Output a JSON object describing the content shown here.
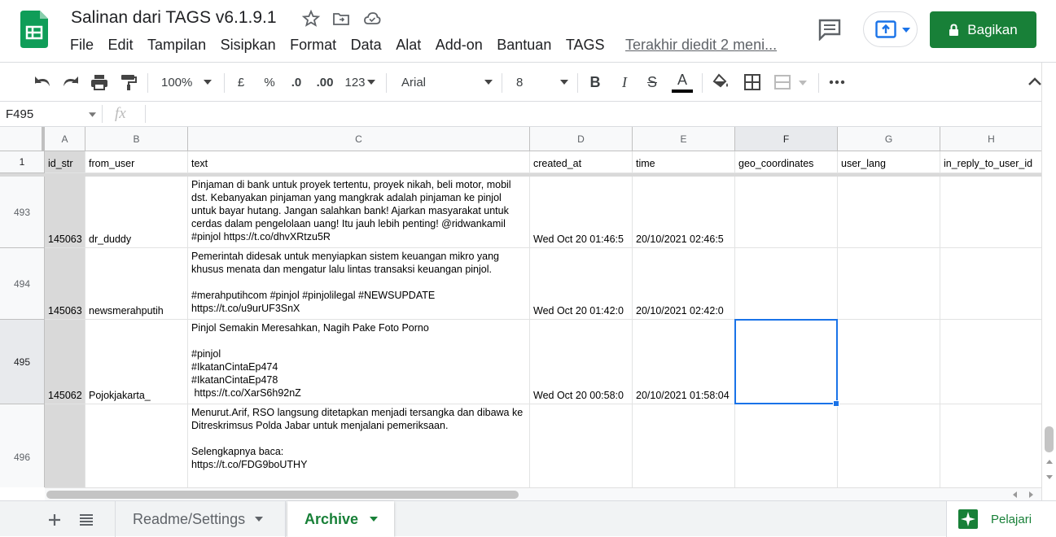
{
  "header": {
    "doc_title": "Salinan dari TAGS v6.1.9.1",
    "menu": [
      "File",
      "Edit",
      "Tampilan",
      "Sisipkan",
      "Format",
      "Data",
      "Alat",
      "Add-on",
      "Bantuan",
      "TAGS"
    ],
    "last_edit": "Terakhir diedit 2 meni...",
    "share_label": "Bagikan",
    "accent": "#188038"
  },
  "toolbar": {
    "zoom": "100%",
    "currency": "£",
    "percent": "%",
    "dec_less": ".0",
    "dec_more": ".00",
    "more_formats": "123",
    "font": "Arial",
    "font_size": "8",
    "bold": "B",
    "italic": "I",
    "strike": "S",
    "text_color": "A"
  },
  "formula_bar": {
    "cell_ref": "F495",
    "fx": "fx",
    "value": ""
  },
  "grid": {
    "columns": [
      "A",
      "B",
      "C",
      "D",
      "E",
      "F",
      "G",
      "H"
    ],
    "header_row_number": "1",
    "header_values": [
      "id_str",
      "from_user",
      "text",
      "created_at",
      "time",
      "geo_coordinates",
      "user_lang",
      "in_reply_to_user_id"
    ],
    "rows": [
      {
        "num": "493",
        "a": "145063",
        "b": "dr_duddy",
        "c": "Pinjaman di bank untuk proyek tertentu, proyek nikah, beli motor, mobil dst. Kebanyakan pinjaman yang mangkrak adalah pinjaman ke pinjol untuk bayar hutang. Jangan salahkan bank! Ajarkan masyarakat untuk cerdas dalam pengelolaan uang! Itu jauh lebih penting! @ridwankamil #pinjol https://t.co/dhvXRtzu5R",
        "d": "Wed Oct 20 01:46:5",
        "e": "20/10/2021 02:46:5"
      },
      {
        "num": "494",
        "a": "145063",
        "b": "newsmerahputih",
        "c": "Pemerintah didesak untuk menyiapkan sistem keuangan mikro yang khusus menata dan mengatur lalu lintas transaksi keuangan pinjol.\n\n#merahputihcom #pinjol #pinjolilegal #NEWSUPDATE\nhttps://t.co/u9urUF3SnX",
        "d": "Wed Oct 20 01:42:0",
        "e": "20/10/2021 02:42:0"
      },
      {
        "num": "495",
        "a": "145062",
        "b": "Pojokjakarta_",
        "c": "Pinjol Semakin Meresahkan, Nagih Pake Foto Porno\n\n#pinjol\n#IkatanCintaEp474\n#IkatanCintaEp478\n https://t.co/XarS6h92nZ",
        "d": "Wed Oct 20 00:58:0",
        "e": "20/10/2021 01:58:04"
      },
      {
        "num": "496",
        "a": "",
        "b": "",
        "c": "Menurut.Arif, RSO langsung ditetapkan menjadi tersangka dan dibawa ke Ditreskrimsus Polda Jabar untuk menjalani pemeriksaan.\n\nSelengkapnya baca:\nhttps://t.co/FDG9boUTHY",
        "d": "",
        "e": ""
      }
    ]
  },
  "sheets": {
    "tabs": [
      "Readme/Settings",
      "Archive"
    ],
    "active": "Archive",
    "explore_label": "Pelajari"
  }
}
